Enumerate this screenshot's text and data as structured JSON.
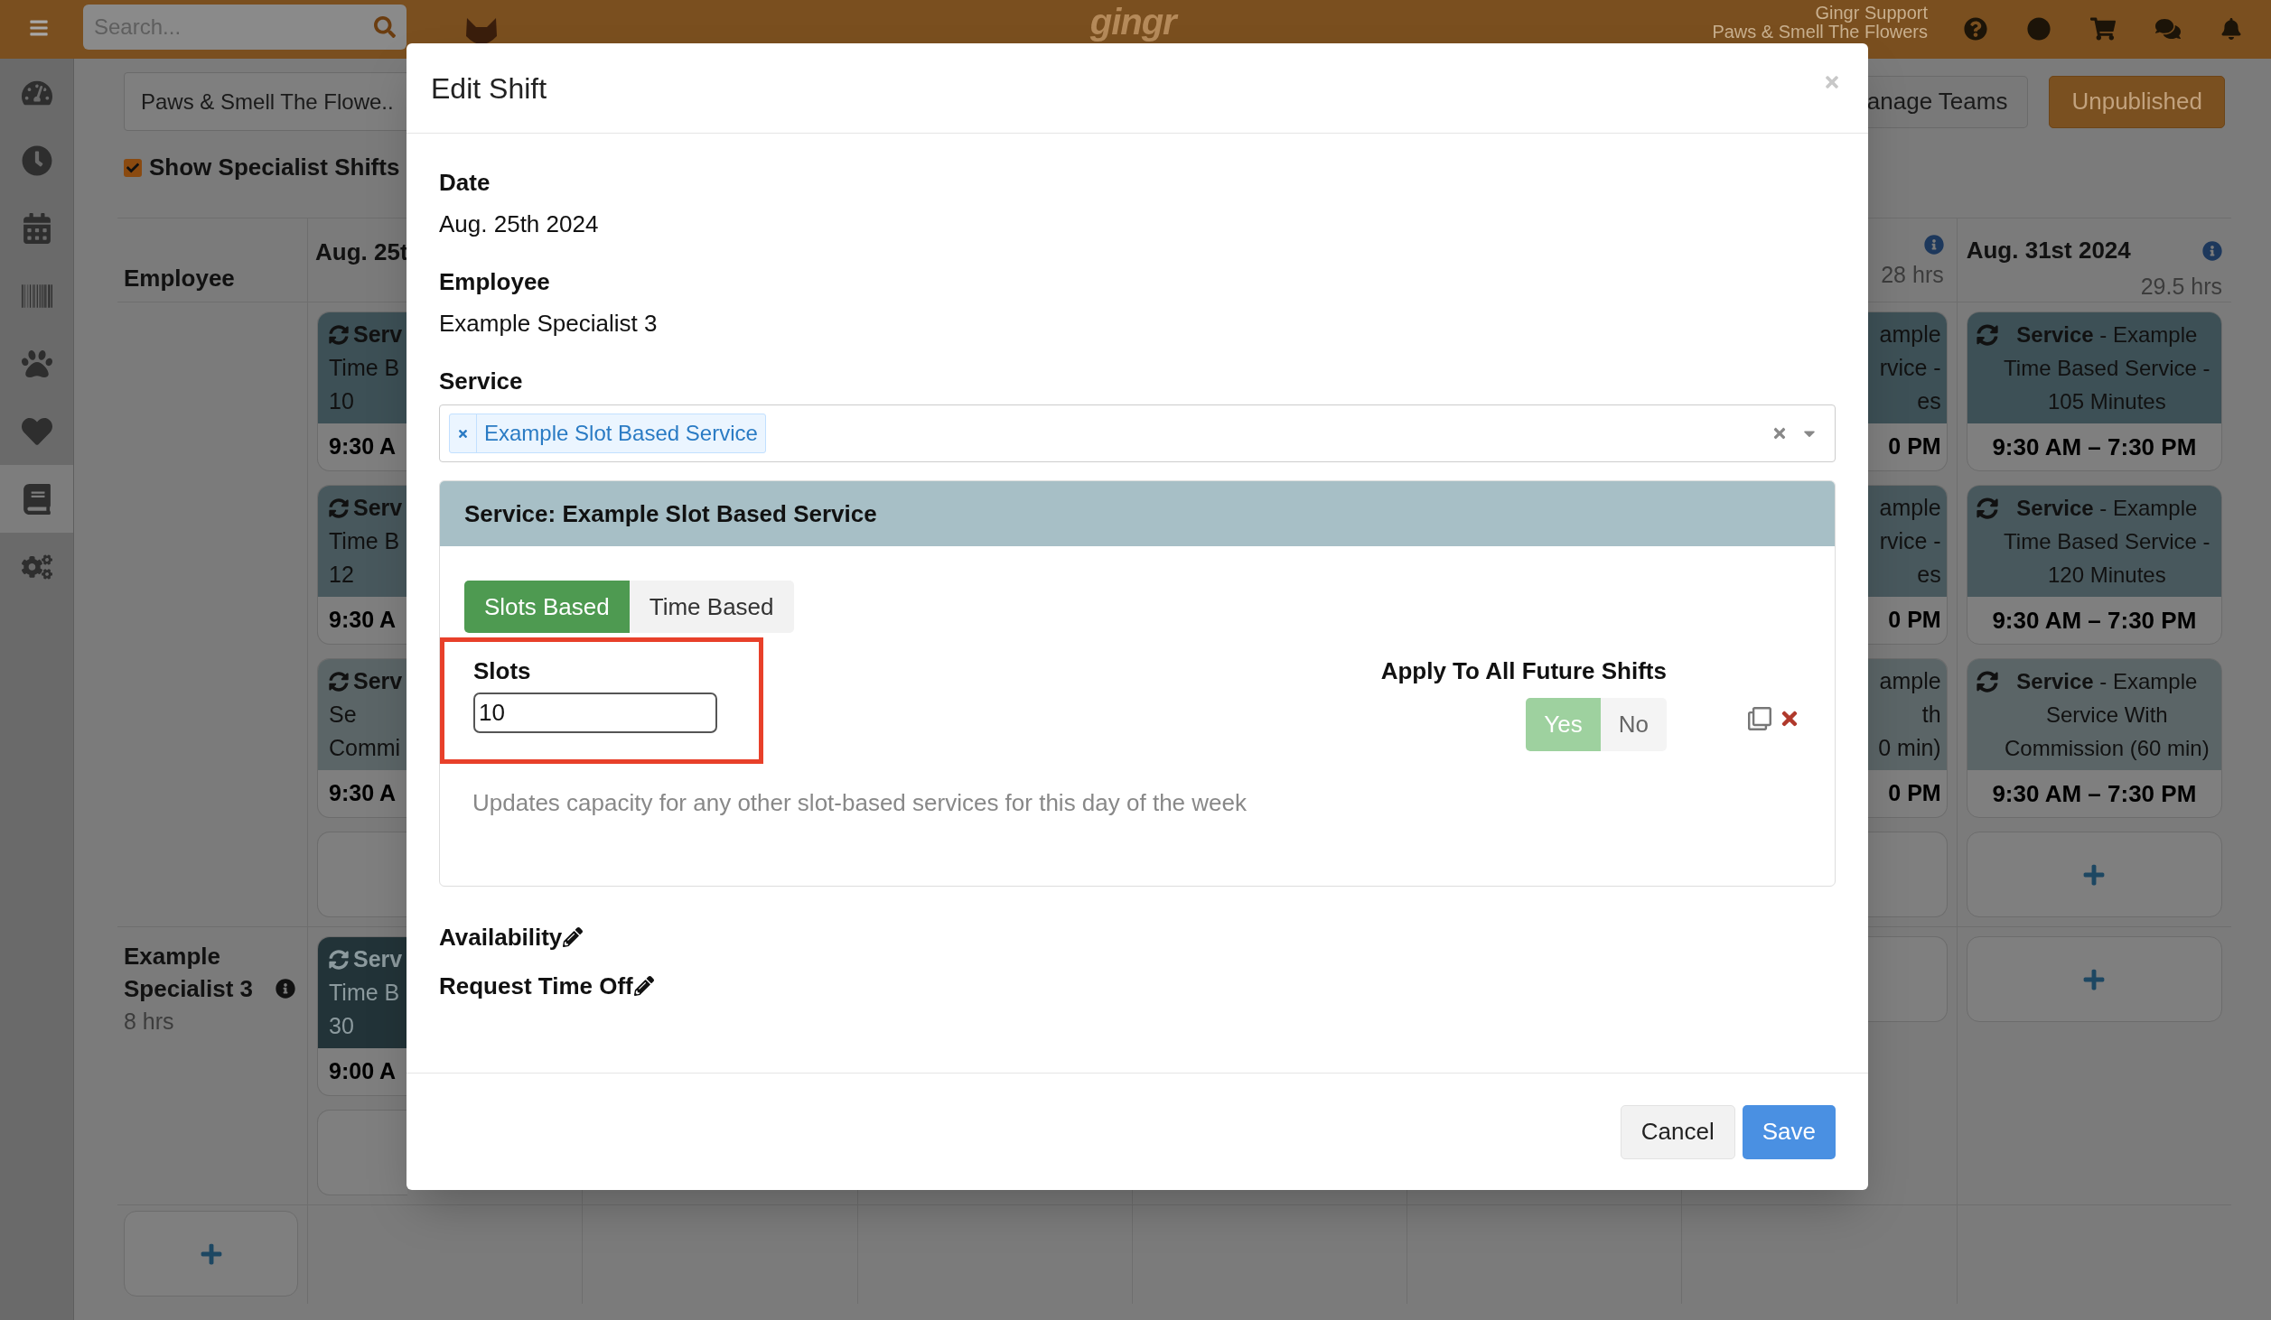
{
  "top_bar": {
    "search": {
      "placeholder": "Search..."
    },
    "logo": "gingr",
    "user": {
      "name": "Gingr Support",
      "location": "Paws & Smell The Flowers"
    }
  },
  "sidebar": {
    "items": [
      {
        "selected": false
      },
      {
        "selected": false
      },
      {
        "selected": false
      },
      {
        "selected": false
      },
      {
        "selected": false
      },
      {
        "selected": false
      },
      {
        "selected": true
      },
      {
        "selected": false
      }
    ]
  },
  "toolbar": {
    "location_select": "Paws & Smell The Flowe..",
    "show_specialist_shifts": {
      "label": "Show Specialist Shifts",
      "checked": true
    },
    "manage_teams": "anage Teams",
    "publish_status": "Unpublished"
  },
  "schedule": {
    "employee_header": "Employee",
    "columns": [
      {
        "kind": "cut_left",
        "date": "Aug. 25t"
      },
      {
        "kind": "cut_right",
        "hours": "28 hrs"
      },
      {
        "kind": "full",
        "date": "Aug. 31st 2024",
        "hours": "29.5 hrs"
      }
    ],
    "rows": [
      {
        "cells": [
          [
            {
              "kind": "shift",
              "color": "#3d5056",
              "title": "Serv",
              "lines": [
                "Time B",
                "10"
              ],
              "time": "9:30 A"
            },
            {
              "kind": "shift",
              "color": "#48585d",
              "title": "Serv",
              "lines": [
                "Time B",
                "12"
              ],
              "time": "9:30 A"
            },
            {
              "kind": "shift",
              "color": "#5b6567",
              "title": "Serv",
              "lines": [
                "Se",
                "Commi"
              ],
              "time": "9:30 A"
            },
            {
              "kind": "add"
            }
          ],
          [
            {
              "kind": "shift",
              "color": "#3d5056",
              "lines": [
                "ample",
                "rvice -",
                "es"
              ],
              "time": "0 PM"
            },
            {
              "kind": "shift",
              "color": "#48585d",
              "lines": [
                "ample",
                "rvice -",
                "es"
              ],
              "time": "0 PM"
            },
            {
              "kind": "shift",
              "color": "#5b6567",
              "lines": [
                "ample",
                "th",
                "0 min)"
              ],
              "time": "0 PM"
            },
            {
              "kind": "add"
            }
          ],
          [
            {
              "kind": "shift",
              "color": "#3d5056",
              "text": "**Service** - Example Time Based Service - 105 Minutes",
              "time": "9:30 AM – 7:30 PM"
            },
            {
              "kind": "shift",
              "color": "#48585d",
              "text": "**Service** - Example Time Based Service - 120 Minutes",
              "time": "9:30 AM – 7:30 PM"
            },
            {
              "kind": "shift",
              "color": "#5b6567",
              "text": "**Service** - Example Service With Commission (60 min)",
              "time": "9:30 AM – 7:30 PM"
            },
            {
              "kind": "add"
            }
          ]
        ]
      },
      {
        "employee": {
          "name": "Example Specialist 3",
          "hours": "8 hrs"
        },
        "cells": [
          [
            {
              "kind": "shift",
              "color": "#223338",
              "title": "Serv",
              "lines": [
                "Time B",
                "30"
              ],
              "time": "9:00 A"
            },
            {
              "kind": "add"
            }
          ],
          [
            {
              "kind": "add"
            }
          ],
          [
            {
              "kind": "add"
            }
          ]
        ]
      }
    ]
  },
  "modal": {
    "title": "Edit Shift",
    "fields": [
      {
        "label": "Date",
        "value": "Aug. 25th 2024"
      },
      {
        "label": "Employee",
        "value": "Example Specialist 3"
      }
    ],
    "service": {
      "label": "Service",
      "selected": [
        "Example Slot Based Service"
      ],
      "panel_title": "Service: Example Slot Based Service",
      "modes": [
        {
          "label": "Slots Based",
          "selected": true
        },
        {
          "label": "Time Based",
          "selected": false
        }
      ],
      "slots": {
        "label": "Slots",
        "value": "10",
        "highlighted": true
      },
      "apply_future": {
        "label": "Apply To All Future Shifts",
        "options": [
          {
            "label": "Yes",
            "selected": true
          },
          {
            "label": "No",
            "selected": false
          }
        ]
      },
      "help": "Updates capacity for any other slot-based services for this day of the week"
    },
    "links": [
      "Availability",
      "Request Time Off"
    ],
    "buttons": [
      {
        "label": "Cancel",
        "kind": "secondary"
      },
      {
        "label": "Save",
        "kind": "primary"
      }
    ]
  }
}
